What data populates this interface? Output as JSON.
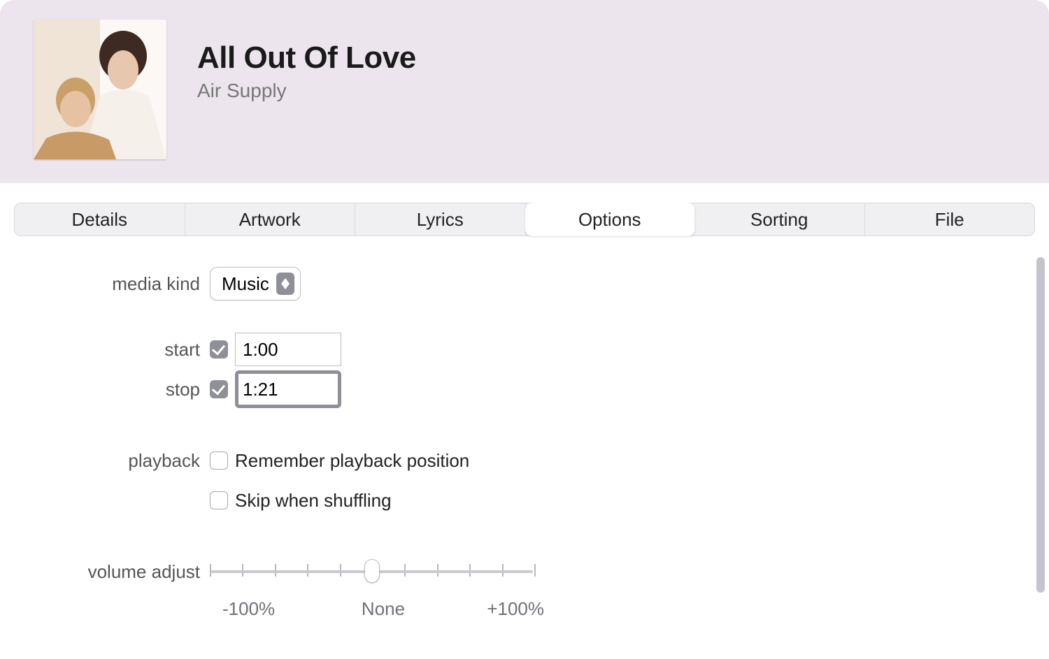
{
  "header": {
    "title": "All Out Of Love",
    "artist": "Air Supply"
  },
  "tabs": [
    {
      "id": "details",
      "label": "Details",
      "active": false
    },
    {
      "id": "artwork",
      "label": "Artwork",
      "active": false
    },
    {
      "id": "lyrics",
      "label": "Lyrics",
      "active": false
    },
    {
      "id": "options",
      "label": "Options",
      "active": true
    },
    {
      "id": "sorting",
      "label": "Sorting",
      "active": false
    },
    {
      "id": "file",
      "label": "File",
      "active": false
    }
  ],
  "form": {
    "media_kind_label": "media kind",
    "media_kind_value": "Music",
    "start_label": "start",
    "start_checked": true,
    "start_value": "1:00",
    "stop_label": "stop",
    "stop_checked": true,
    "stop_value": "1:21",
    "stop_focused": true,
    "playback_label": "playback",
    "remember_checked": false,
    "remember_label": "Remember playback position",
    "skip_checked": false,
    "skip_label": "Skip when shuffling",
    "volume_label": "volume adjust",
    "volume_pos_percent": 50,
    "slider_left": "-100%",
    "slider_mid": "None",
    "slider_right": "+100%"
  }
}
